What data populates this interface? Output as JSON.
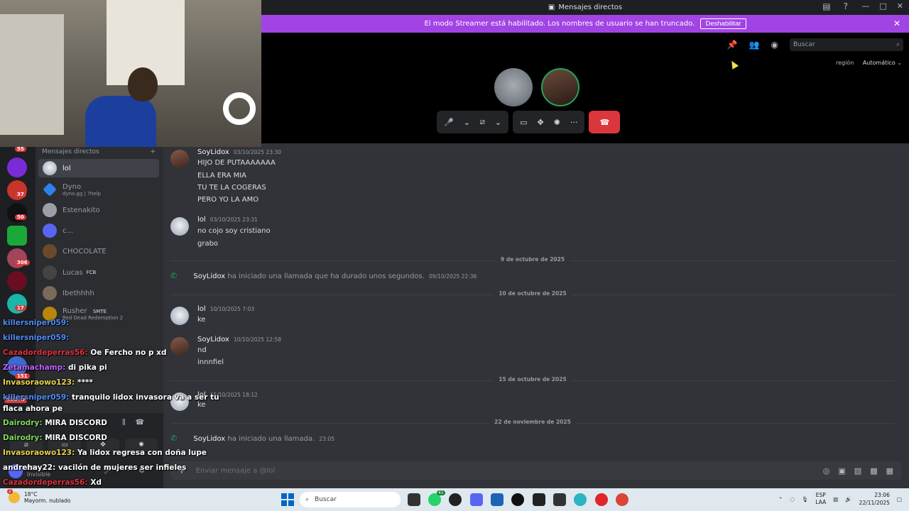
{
  "titlebar": {
    "title": "Mensajes directos"
  },
  "banner": {
    "text": "El modo Streamer está habilitado. Los nombres de usuario se han truncado.",
    "disable_label": "Deshabilitar"
  },
  "call": {
    "search_placeholder": "Buscar",
    "region_label": "región",
    "region_value": "Automático"
  },
  "server_badges": [
    "55",
    "37",
    "50",
    "306",
    "17",
    "151"
  ],
  "server_new_label": "NUEVO",
  "dm": {
    "header": "Mensajes directos",
    "items": [
      {
        "name": "lol",
        "sub": "",
        "tag": ""
      },
      {
        "name": "Dyno",
        "sub": "dyno.gg | ?help",
        "tag": ""
      },
      {
        "name": "Estenakito",
        "sub": "",
        "tag": ""
      },
      {
        "name": "c...",
        "sub": "",
        "tag": ""
      },
      {
        "name": "CHOCOLATE",
        "sub": "",
        "tag": ""
      },
      {
        "name": "Lucas",
        "sub": "",
        "tag": "FCB"
      },
      {
        "name": "Ibethhhh",
        "sub": "",
        "tag": ""
      },
      {
        "name": "Rusher",
        "sub": "Red Dead Redemption 2",
        "tag": "SMTE"
      }
    ]
  },
  "stream_chat": [
    {
      "user": "killersniper059:",
      "text": "",
      "color": "u-blue"
    },
    {
      "user": "killersniper059:",
      "text": "",
      "color": "u-blue"
    },
    {
      "user": "Cazadordeperras56:",
      "text": "Oe Fercho no p xd",
      "color": "u-red"
    },
    {
      "user": "Zetamachamp:",
      "text": "di pika pi",
      "color": "u-purple"
    },
    {
      "user": "Invasoraowo123:",
      "text": "****",
      "color": "u-yellow"
    },
    {
      "user": "killersniper059:",
      "text": "tranquilo lidox invasora va a ser tu flaca ahora pe",
      "color": "u-blue"
    },
    {
      "user": "Dairodry:",
      "text": "MIRA DISCORD",
      "color": "u-green"
    },
    {
      "user": "Dairodry:",
      "text": "MIRA DISCORD",
      "color": "u-green"
    },
    {
      "user": "Invasoraowo123:",
      "text": "Ya lidox regresa con doña lupe",
      "color": "u-yellow"
    },
    {
      "user": "andrehay22:",
      "text": "vacilón de mujeres ser infieles",
      "color": "u-white"
    },
    {
      "user": "Cazadordeperras56:",
      "text": "Xd",
      "color": "u-red"
    }
  ],
  "self": {
    "name": "lol",
    "status": "Invisible"
  },
  "messages": {
    "m1": {
      "author": "SoyLidox",
      "time": "03/10/2025 23:30",
      "lines": [
        "HIJO DE PUTAAAAAAA",
        "ELLA ERA MIA",
        "TU TE LA COGERAS",
        "PERO YO LA AMO"
      ]
    },
    "m2": {
      "author": "lol",
      "time": "03/10/2025 23:31",
      "lines": [
        "no cojo soy cristiano",
        "grabo"
      ]
    },
    "d1": "9 de octubre de 2025",
    "s1": {
      "author": "SoyLidox",
      "text": "ha iniciado una llamada que ha durado unos segundos.",
      "time": "09/10/2025 22:36"
    },
    "d2": "10 de octubre de 2025",
    "m3": {
      "author": "lol",
      "time": "10/10/2025 7:03",
      "lines": [
        "ke"
      ]
    },
    "m4": {
      "author": "SoyLidox",
      "time": "10/10/2025 12:58",
      "lines": [
        "nd",
        "innnfiel"
      ]
    },
    "d3": "15 de octubre de 2025",
    "m5": {
      "author": "lol",
      "time": "15/10/2025 18:12",
      "lines": [
        "ke"
      ]
    },
    "d4": "22 de noviembre de 2025",
    "s2": {
      "author": "SoyLidox",
      "text": "ha iniciado una llamada.",
      "time": "23:05"
    }
  },
  "composer": {
    "placeholder": "Enviar mensaje a @lol"
  },
  "taskbar": {
    "weather_temp": "18°C",
    "weather_desc": "Mayorm. nublado",
    "weather_badge": "2",
    "search_label": "Buscar",
    "lang_1": "ESP",
    "lang_2": "LAA",
    "time": "23:06",
    "date": "22/11/2025",
    "whatsapp_badge": "41"
  },
  "colors": {
    "banner": "#a244e4",
    "end_call": "#da373c",
    "online": "#23a55a",
    "blurple": "#5865f2"
  }
}
